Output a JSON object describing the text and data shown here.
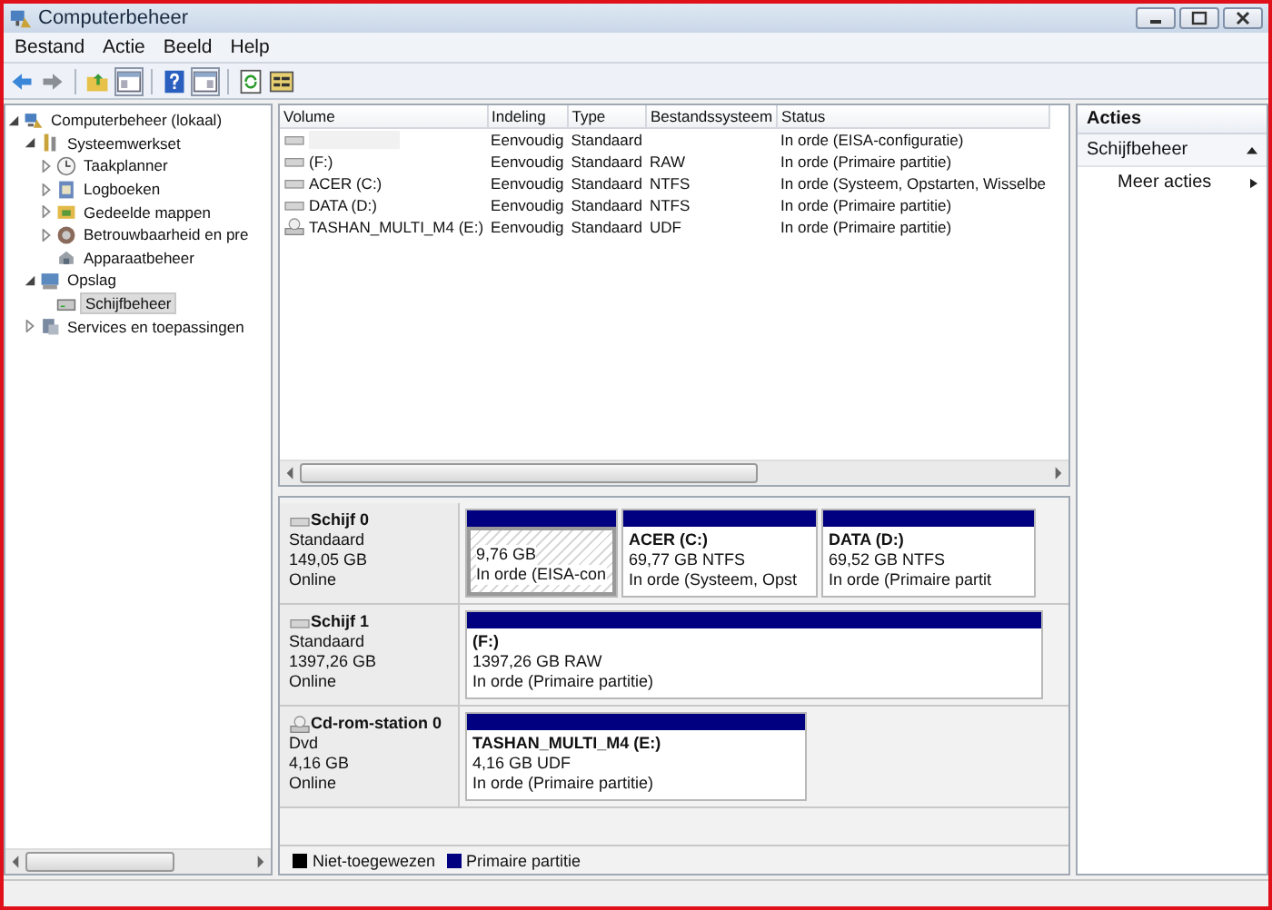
{
  "window": {
    "title": "Computerbeheer"
  },
  "menu": [
    "Bestand",
    "Actie",
    "Beeld",
    "Help"
  ],
  "tree": [
    {
      "label": "Computerbeheer (lokaal)",
      "expanded": true,
      "selected": false,
      "children": [
        {
          "label": "Systeemwerkset",
          "expanded": true,
          "selected": false,
          "children": [
            {
              "label": "Taakplanner",
              "expanded": false,
              "selected": false
            },
            {
              "label": "Logboeken",
              "expanded": false,
              "selected": false
            },
            {
              "label": "Gedeelde mappen",
              "expanded": false,
              "selected": false
            },
            {
              "label": "Betrouwbaarheid en pre",
              "expanded": false,
              "selected": false
            },
            {
              "label": "Apparaatbeheer",
              "selected": false
            }
          ]
        },
        {
          "label": "Opslag",
          "expanded": true,
          "selected": false,
          "children": [
            {
              "label": "Schijfbeheer",
              "selected": true
            }
          ]
        },
        {
          "label": "Services en toepassingen",
          "expanded": false,
          "selected": false
        }
      ]
    }
  ],
  "volume_table": {
    "columns": [
      "Volume",
      "Indeling",
      "Type",
      "Bestandssysteem",
      "Status"
    ],
    "rows": [
      {
        "kind": "disk",
        "layout": "Eenvoudig",
        "type": "Standaard",
        "status": "In orde (EISA-configuratie)"
      },
      {
        "kind": "disk",
        "volume": "(F:)",
        "layout": "Eenvoudig",
        "type": "Standaard",
        "filesystem": "RAW",
        "status": "In orde (Primaire partitie)"
      },
      {
        "kind": "disk",
        "volume": "ACER (C:)",
        "layout": "Eenvoudig",
        "type": "Standaard",
        "filesystem": "NTFS",
        "status": "In orde (Systeem, Opstarten, Wisselbe"
      },
      {
        "kind": "disk",
        "volume": "DATA (D:)",
        "layout": "Eenvoudig",
        "type": "Standaard",
        "filesystem": "NTFS",
        "status": "In orde (Primaire partitie)"
      },
      {
        "kind": "cdrom",
        "volume": "TASHAN_MULTI_M4 (E:)",
        "layout": "Eenvoudig",
        "type": "Standaard",
        "filesystem": "UDF",
        "status": "In orde (Primaire partitie)"
      }
    ]
  },
  "disks": [
    {
      "kind": "disk",
      "name": "Schijf 0",
      "type": "Standaard",
      "size": "149,05 GB",
      "state": "Online",
      "partitions": [
        {
          "kind": "primary",
          "selected": true,
          "size": "9,76 GB",
          "status": "In orde (EISA-con"
        },
        {
          "kind": "primary",
          "selected": false,
          "name": "ACER  (C:)",
          "size": "69,77 GB NTFS",
          "status": "In orde (Systeem, Opst"
        },
        {
          "kind": "primary",
          "selected": false,
          "name": "DATA  (D:)",
          "size": "69,52 GB NTFS",
          "status": "In orde (Primaire partit"
        }
      ]
    },
    {
      "kind": "disk",
      "name": "Schijf 1",
      "type": "Standaard",
      "size": "1397,26 GB",
      "state": "Online",
      "partitions": [
        {
          "kind": "primary",
          "selected": false,
          "name": "(F:)",
          "size": "1397,26 GB RAW",
          "status": "In orde (Primaire partitie)"
        }
      ]
    },
    {
      "kind": "cdrom",
      "name": "Cd-rom-station 0",
      "type": "Dvd",
      "size": "4,16 GB",
      "state": "Online",
      "partitions": [
        {
          "kind": "primary",
          "selected": false,
          "name": "TASHAN_MULTI_M4  (E:)",
          "size": "4,16 GB UDF",
          "status": "In orde (Primaire partitie)"
        }
      ]
    }
  ],
  "legend": [
    {
      "label": "Niet-toegewezen",
      "color": "#000000"
    },
    {
      "label": "Primaire partitie",
      "color": "#000080"
    }
  ],
  "actions": {
    "title": "Acties",
    "sections": [
      {
        "label": "Schijfbeheer",
        "expanded": true,
        "items": [
          "Meer acties"
        ]
      }
    ]
  }
}
